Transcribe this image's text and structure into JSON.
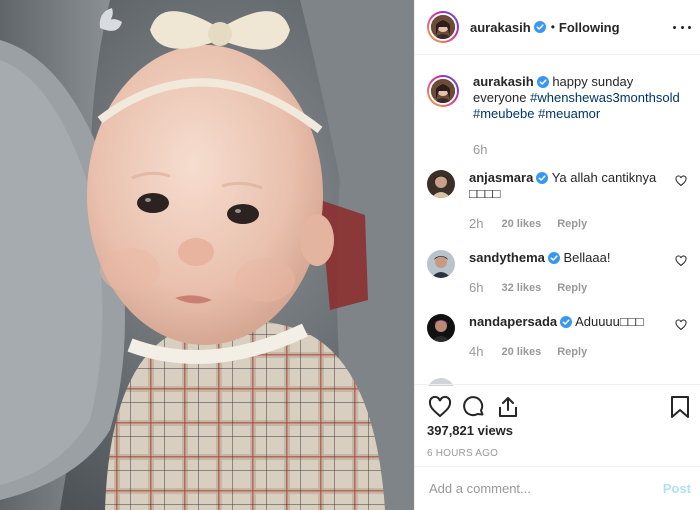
{
  "header": {
    "username": "aurakasih",
    "separator": "•",
    "follow_status": "Following"
  },
  "caption": {
    "username": "aurakasih",
    "text": "happy sunday everyone",
    "hashtags": [
      "#whenshewas3monthsold",
      "#meubebe",
      "#meuamor"
    ],
    "time": "6h"
  },
  "comments": [
    {
      "username": "anjasmara",
      "text": "Ya allah cantiknya □□□□",
      "time": "2h",
      "likes": "20 likes",
      "reply": "Reply"
    },
    {
      "username": "sandythema",
      "text": "Bellaaa!",
      "time": "6h",
      "likes": "32 likes",
      "reply": "Reply"
    },
    {
      "username": "nandapersada",
      "text": "Aduuuu□□□",
      "time": "4h",
      "likes": "20 likes",
      "reply": "Reply"
    }
  ],
  "actions": {
    "views": "397,821 views",
    "time_ago": "6 HOURS AGO"
  },
  "add_comment": {
    "placeholder": "Add a comment...",
    "post_label": "Post"
  },
  "icons": {
    "like": "heart-icon",
    "comment": "comment-bubble-icon",
    "share": "share-icon",
    "save": "bookmark-icon",
    "options": "more-options-icon",
    "verified": "verified-badge-icon"
  },
  "colors": {
    "verified_blue": "#3897f0",
    "hashtag_blue": "#003569",
    "muted_text": "#999999",
    "post_button_disabled": "#b2dffc"
  }
}
